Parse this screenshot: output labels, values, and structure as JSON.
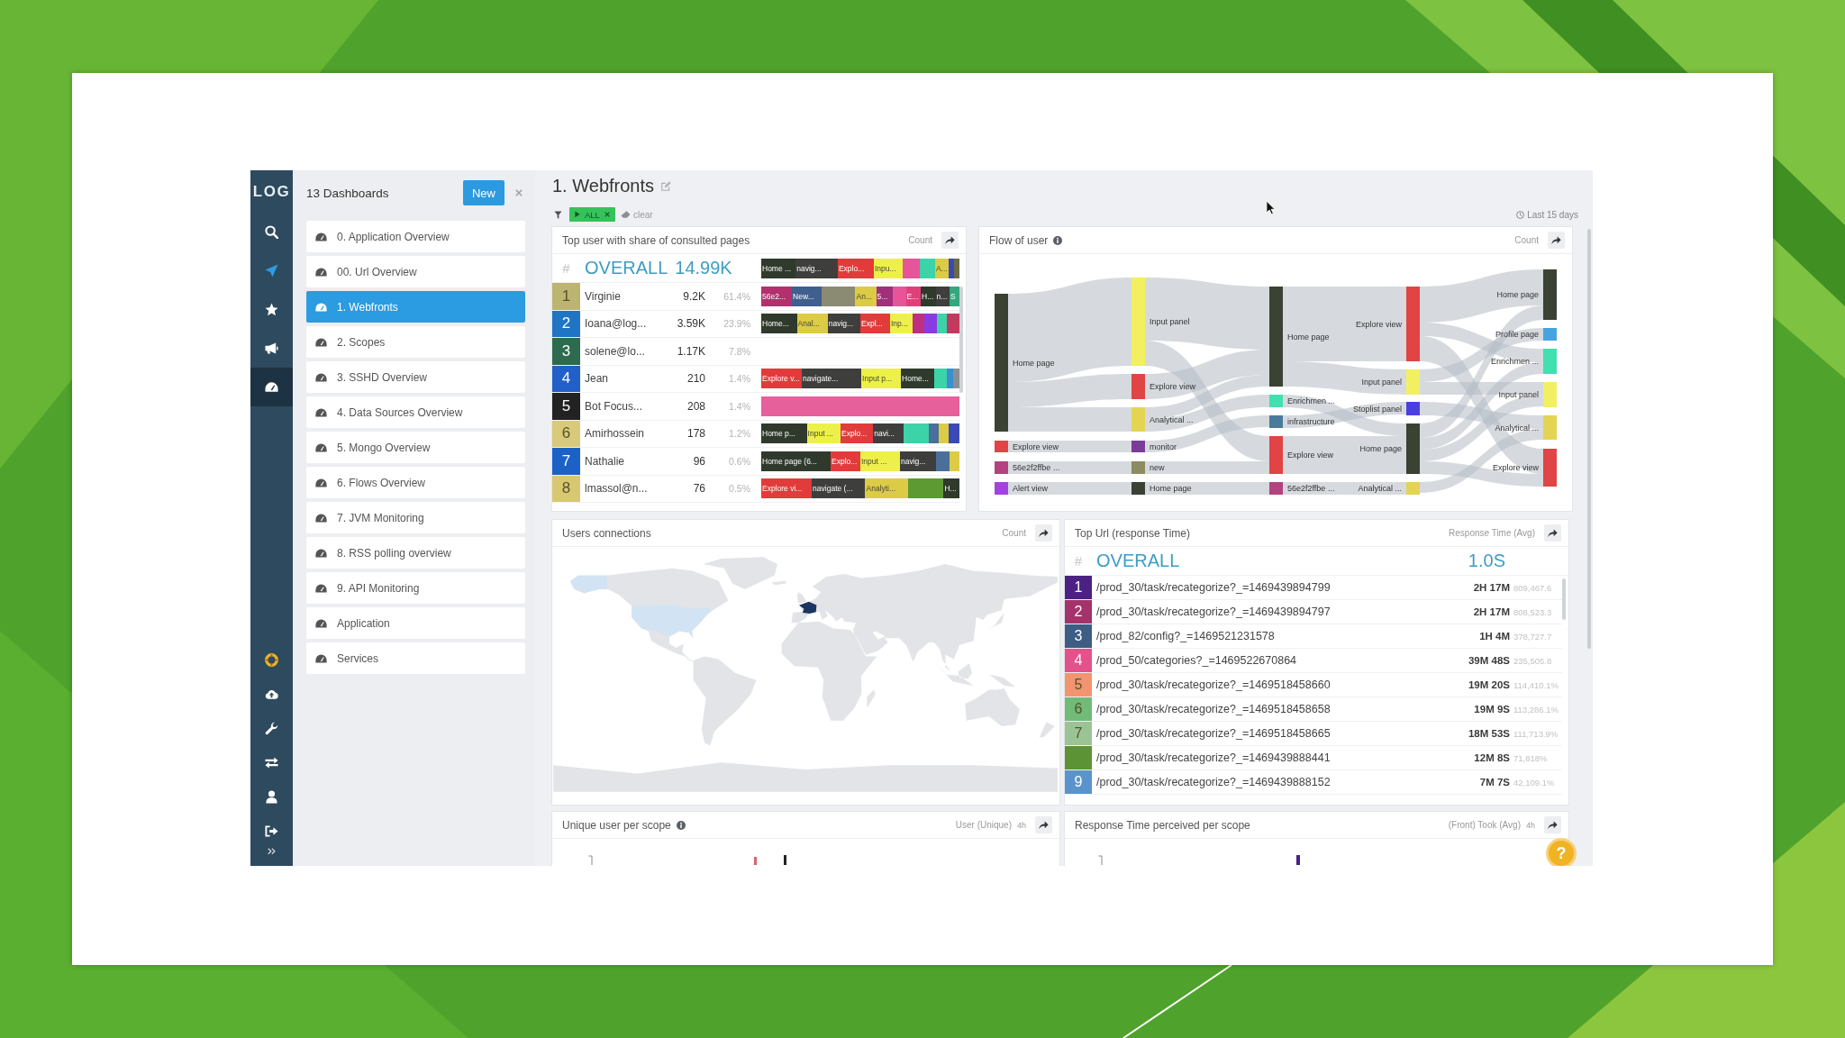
{
  "nav_rail": {
    "logo": "LOG",
    "top_items": [
      {
        "selected": false
      },
      {
        "selected": false
      },
      {
        "selected": false
      },
      {
        "selected": false
      },
      {
        "selected": true
      }
    ],
    "bottom_items": [
      {
        "selected": false
      },
      {
        "selected": false
      },
      {
        "selected": false
      },
      {
        "selected": false
      },
      {
        "selected": false
      },
      {
        "selected": false
      },
      {
        "selected": false
      }
    ]
  },
  "dashboards_panel": {
    "title": "13 Dashboards",
    "new_button": "New",
    "items": [
      {
        "label": "0. Application Overview",
        "selected": false
      },
      {
        "label": "00. Url Overview",
        "selected": false
      },
      {
        "label": "1. Webfronts",
        "selected": true
      },
      {
        "label": "2. Scopes",
        "selected": false
      },
      {
        "label": "3. SSHD Overview",
        "selected": false
      },
      {
        "label": "4. Data Sources Overview",
        "selected": false
      },
      {
        "label": "5. Mongo Overview",
        "selected": false
      },
      {
        "label": "6. Flows Overview",
        "selected": false
      },
      {
        "label": "7. JVM Monitoring",
        "selected": false
      },
      {
        "label": "8. RSS polling overview",
        "selected": false
      },
      {
        "label": "9. API Monitoring",
        "selected": false
      },
      {
        "label": "Application",
        "selected": false
      },
      {
        "label": "Services",
        "selected": false
      }
    ]
  },
  "page": {
    "title": "1. Webfronts",
    "filter_chip": "ALL",
    "clear_button": "clear",
    "time_range": "Last 15 days"
  },
  "top_users": {
    "title": "Top user with share of consulted pages",
    "metric": "Count",
    "overall": {
      "hash": "#",
      "label": "OVERALL",
      "value": "14.99K",
      "segments": [
        {
          "label": "Home ...",
          "color": "#2f3a2c"
        },
        {
          "label": "navig...",
          "color": "#3e3f3d"
        },
        {
          "label": "Explo...",
          "color": "#e23b3b"
        },
        {
          "label": "Inpu...",
          "color": "#eef04a"
        },
        {
          "color": "#e6559a"
        },
        {
          "color": "#3dd3a8"
        },
        {
          "label": "A...",
          "color": "#dccb45"
        },
        {
          "color": "#3a4ab5"
        },
        {
          "color": "#6b6b45"
        }
      ]
    },
    "rows": [
      {
        "rank": "1",
        "color": "#bcb572",
        "name": "Virginie",
        "count": "9.2K",
        "percent": "61.4%",
        "segments": [
          {
            "label": "56e2...",
            "color": "#b3306d"
          },
          {
            "label": "New...",
            "color": "#3f5f8e"
          },
          {
            "color": "#8b8a72"
          },
          {
            "label": "An...",
            "color": "#dccb45"
          },
          {
            "label": "5...",
            "color": "#a0307a"
          },
          {
            "color": "#e6559a"
          },
          {
            "label": "E...",
            "color": "#e0407a"
          },
          {
            "label": "H...",
            "color": "#2f3a2c"
          },
          {
            "label": "n...",
            "color": "#3e3f3d"
          },
          {
            "label": "S",
            "color": "#34a77e"
          }
        ]
      },
      {
        "rank": "2",
        "color": "#1f74c4",
        "name": "Ioana@log...",
        "count": "3.59K",
        "percent": "23.9%",
        "segments": [
          {
            "label": "Home...",
            "color": "#2f3a2c"
          },
          {
            "label": "Anal...",
            "color": "#dccb45"
          },
          {
            "label": "navig...",
            "color": "#3e3f3d"
          },
          {
            "label": "Expl...",
            "color": "#e23b3b"
          },
          {
            "label": "Inp...",
            "color": "#eef04a"
          },
          {
            "color": "#c03080"
          },
          {
            "color": "#8a3ae2"
          },
          {
            "color": "#3dd3a8"
          },
          {
            "color": "#c23a5e"
          }
        ]
      },
      {
        "rank": "3",
        "color": "#2e6a50",
        "name": "solene@lo...",
        "count": "1.17K",
        "percent": "7.8%"
      },
      {
        "rank": "4",
        "color": "#2160c8",
        "name": "Jean",
        "count": "210",
        "percent": "1.4%",
        "segments": [
          {
            "label": "Explore v...",
            "color": "#e23b3b"
          },
          {
            "label": "navigate...",
            "color": "#3e3f3d"
          },
          {
            "label": "Input p...",
            "color": "#eef04a"
          },
          {
            "label": "Home...",
            "color": "#2f3a2c"
          },
          {
            "color": "#3dd3a8"
          },
          {
            "color": "#3a8fd0"
          },
          {
            "color": "#8a8f96"
          }
        ]
      },
      {
        "rank": "5",
        "color": "#222222",
        "name": "Bot Focus...",
        "count": "208",
        "percent": "1.4%",
        "segments": [
          {
            "color": "#e6609c"
          }
        ]
      },
      {
        "rank": "6",
        "color": "#d9c97a",
        "name": "Amirhossein",
        "count": "178",
        "percent": "1.2%",
        "segments": [
          {
            "label": "Home p...",
            "color": "#2f3a2c"
          },
          {
            "label": "Input ...",
            "color": "#eef04a"
          },
          {
            "label": "Explo...",
            "color": "#e23b3b"
          },
          {
            "label": "navi...",
            "color": "#3e3f3d"
          },
          {
            "color": "#3dd3a8"
          },
          {
            "color": "#4a6f9a"
          },
          {
            "color": "#dccb45"
          },
          {
            "color": "#3a4ab5"
          }
        ]
      },
      {
        "rank": "7",
        "color": "#1c62c6",
        "name": "Nathalie",
        "count": "96",
        "percent": "0.6%",
        "segments": [
          {
            "label": "Home page (6...",
            "color": "#2f3a2c"
          },
          {
            "label": "Explo...",
            "color": "#e23b3b"
          },
          {
            "label": "Input ...",
            "color": "#eef04a"
          },
          {
            "label": "navig...",
            "color": "#3e3f3d"
          },
          {
            "color": "#4a6f9a"
          },
          {
            "color": "#dccb45"
          }
        ]
      },
      {
        "rank": "8",
        "color": "#d8c872",
        "name": "lmassol@n...",
        "count": "76",
        "percent": "0.5%",
        "segments": [
          {
            "label": "Explore vi...",
            "color": "#e23b3b"
          },
          {
            "label": "navigate (...",
            "color": "#3e3f3d"
          },
          {
            "label": "Analyti...",
            "color": "#dccb45"
          },
          {
            "color": "#5d9a32"
          },
          {
            "label": "H...",
            "color": "#2f3a2c"
          }
        ]
      }
    ]
  },
  "flow_of_user": {
    "title": "Flow of user",
    "metric": "Count",
    "columns": [
      {
        "nodes": [
          {
            "label": "Home page",
            "color": "#3a4333"
          },
          {
            "label": "Explore view",
            "color": "#e04444"
          },
          {
            "label": "56e2f2ffbe ...",
            "color": "#b2437f"
          },
          {
            "label": "Alert view",
            "color": "#a442e0"
          }
        ]
      },
      {
        "nodes": [
          {
            "label": "Input panel",
            "color": "#f2f060"
          },
          {
            "label": "Explore view",
            "color": "#e04444"
          },
          {
            "label": "Analytical ...",
            "color": "#e3d451"
          },
          {
            "label": "monitor",
            "color": "#7b3c98"
          },
          {
            "label": "new",
            "color": "#8c8b62"
          },
          {
            "label": "Home page",
            "color": "#3a4333"
          }
        ]
      },
      {
        "nodes": [
          {
            "label": "Home page",
            "color": "#3a4333"
          },
          {
            "label": "Enrichmen ...",
            "color": "#42dfb0"
          },
          {
            "label": "infrastructure",
            "color": "#4b7b9b"
          },
          {
            "label": "Explore view",
            "color": "#e04444"
          },
          {
            "label": "56e2f2ffbe ...",
            "color": "#b2437f"
          }
        ]
      },
      {
        "nodes": [
          {
            "label": "Explore view",
            "color": "#e04444"
          },
          {
            "label": "Input panel",
            "color": "#f2f060"
          },
          {
            "label": "Stoplist panel",
            "color": "#4a40e0"
          },
          {
            "label": "Home page",
            "color": "#3a4333"
          },
          {
            "label": "Analytical ...",
            "color": "#e3d451"
          }
        ]
      },
      {
        "nodes": [
          {
            "label": "Home page",
            "color": "#3a4333"
          },
          {
            "label": "Profile page",
            "color": "#45a4e0"
          },
          {
            "label": "Enrichmen ...",
            "color": "#42dfb0"
          },
          {
            "label": "Input panel",
            "color": "#f2f060"
          },
          {
            "label": "Analytical ...",
            "color": "#e3d451"
          },
          {
            "label": "Explore view",
            "color": "#e04444"
          }
        ]
      }
    ]
  },
  "users_connections": {
    "title": "Users connections",
    "metric": "Count"
  },
  "top_url": {
    "title": "Top Url (response Time)",
    "metric": "Response Time (Avg)",
    "overall": {
      "hash": "#",
      "label": "OVERALL",
      "value": "1.0S"
    },
    "rows": [
      {
        "rank": "1",
        "color": "#4b2283",
        "url": "/prod_30/task/recategorize?_=1469439894799",
        "duration": "2H 17M",
        "value": "809,467.6"
      },
      {
        "rank": "2",
        "color": "#a3336a",
        "url": "/prod_30/task/recategorize?_=1469439894797",
        "duration": "2H 17M",
        "value": "808,523.3"
      },
      {
        "rank": "3",
        "color": "#3d5d85",
        "url": "/prod_82/config?_=1469521231578",
        "duration": "1H 4M",
        "value": "378,727.7"
      },
      {
        "rank": "4",
        "color": "#e4528c",
        "url": "/prod_50/categories?_=1469522670864",
        "duration": "39M 48S",
        "value": "235,505.8"
      },
      {
        "rank": "5",
        "color": "#f29470",
        "url": "/prod_30/task/recategorize?_=1469518458660",
        "duration": "19M 20S",
        "value": "114,410.1%"
      },
      {
        "rank": "6",
        "color": "#70bb78",
        "url": "/prod_30/task/recategorize?_=1469518458658",
        "duration": "19M 9S",
        "value": "113,286.1%"
      },
      {
        "rank": "7",
        "color": "#9cc394",
        "url": "/prod_30/task/recategorize?_=1469518458665",
        "duration": "18M 53S",
        "value": "111,713.9%"
      },
      {
        "color": "#5c9334",
        "url": "/prod_30/task/recategorize?_=1469439888441",
        "duration": "12M 8S",
        "value": "71,818%"
      },
      {
        "rank": "9",
        "color": "#5b94cc",
        "url": "/prod_30/task/recategorize?_=1469439888152",
        "duration": "7M 7S",
        "value": "42,109.1%"
      }
    ]
  },
  "unique_user_per_scope": {
    "title": "Unique user per scope",
    "metric": "User (Unique)",
    "interval": "4h"
  },
  "response_time_per_scope": {
    "title": "Response Time perceived per scope",
    "metric": "(Front) Took (Avg)",
    "interval": "4h"
  },
  "help_button": "?"
}
